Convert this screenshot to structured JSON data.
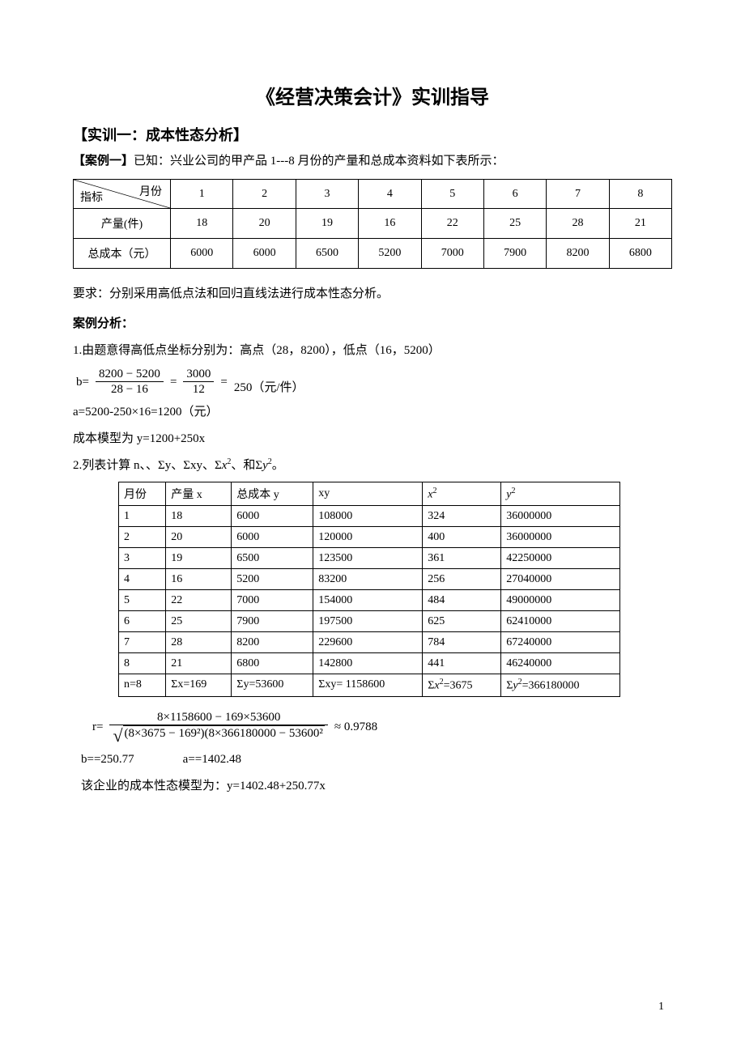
{
  "title": "《经营决策会计》实训指导",
  "subtitle": "【实训一：成本性态分析】",
  "caseLabel": "【案例一】",
  "caseIntro": "已知：兴业公司的甲产品 1---8 月份的产量和总成本资料如下表所示：",
  "table1": {
    "diagTop": "月份",
    "diagBottom": "指标",
    "months": [
      "1",
      "2",
      "3",
      "4",
      "5",
      "6",
      "7",
      "8"
    ],
    "rowLabels": [
      "产量(件)",
      "总成本（元）"
    ],
    "qty": [
      "18",
      "20",
      "19",
      "16",
      "22",
      "25",
      "28",
      "21"
    ],
    "cost": [
      "6000",
      "6000",
      "6500",
      "5200",
      "7000",
      "7900",
      "8200",
      "6800"
    ]
  },
  "requirement": "要求：分别采用高低点法和回归直线法进行成本性态分析。",
  "analysisLabel": "案例分析：",
  "step1": "1.由题意得高低点坐标分别为：高点（28，8200），低点（16，5200）",
  "bEq": {
    "lead": "b=",
    "num1": "8200 − 5200",
    "den1": "28 − 16",
    "eq1": "=",
    "num2": "3000",
    "den2": "12",
    "eq2": "=",
    "tail": "250（元/件）"
  },
  "aEq": "a=5200-250×16=1200（元）",
  "modelEq": "成本模型为   y=1200+250x",
  "step2": {
    "pre": "2.列表计算 n、、Σy、Σxy、Σ",
    "mid": "、和Σ",
    "post": "。",
    "x": "x",
    "y": "y",
    "two": "2"
  },
  "table2": {
    "headers": {
      "c0": "月份",
      "c1": "产量 x",
      "c2": "总成本 y",
      "c3": "xy",
      "c4base": "x",
      "c4sup": "2",
      "c5base": "y",
      "c5sup": "2"
    },
    "rows": [
      [
        "1",
        "18",
        "6000",
        "108000",
        "324",
        "36000000"
      ],
      [
        "2",
        "20",
        "6000",
        "120000",
        "400",
        "36000000"
      ],
      [
        "3",
        "19",
        "6500",
        "123500",
        "361",
        "42250000"
      ],
      [
        "4",
        "16",
        "5200",
        "83200",
        "256",
        "27040000"
      ],
      [
        "5",
        "22",
        "7000",
        "154000",
        "484",
        "49000000"
      ],
      [
        "6",
        "25",
        "7900",
        "197500",
        "625",
        "62410000"
      ],
      [
        "7",
        "28",
        "8200",
        "229600",
        "784",
        "67240000"
      ],
      [
        "8",
        "21",
        "6800",
        "142800",
        "441",
        "46240000"
      ]
    ],
    "totals": {
      "c0": "n=8",
      "c1": "Σx=169",
      "c2": "Σy=53600",
      "c3": "Σxy= 1158600",
      "c4pre": "Σ",
      "c4base": "x",
      "c4sup": "2",
      "c4post": "=3675",
      "c5pre": "Σ",
      "c5base": "y",
      "c5sup": "2",
      "c5post": "=366180000"
    }
  },
  "rFormula": {
    "lead": "r=",
    "num": "8×1158600 − 169×53600",
    "denInner": "(8×3675 − 169²)(8×366180000 − 53600²",
    "tail": "≈ 0.9788"
  },
  "baLine": "b==250.77                a==1402.48",
  "finalModel": "该企业的成本性态模型为：y=1402.48+250.77x",
  "pageNum": "1"
}
